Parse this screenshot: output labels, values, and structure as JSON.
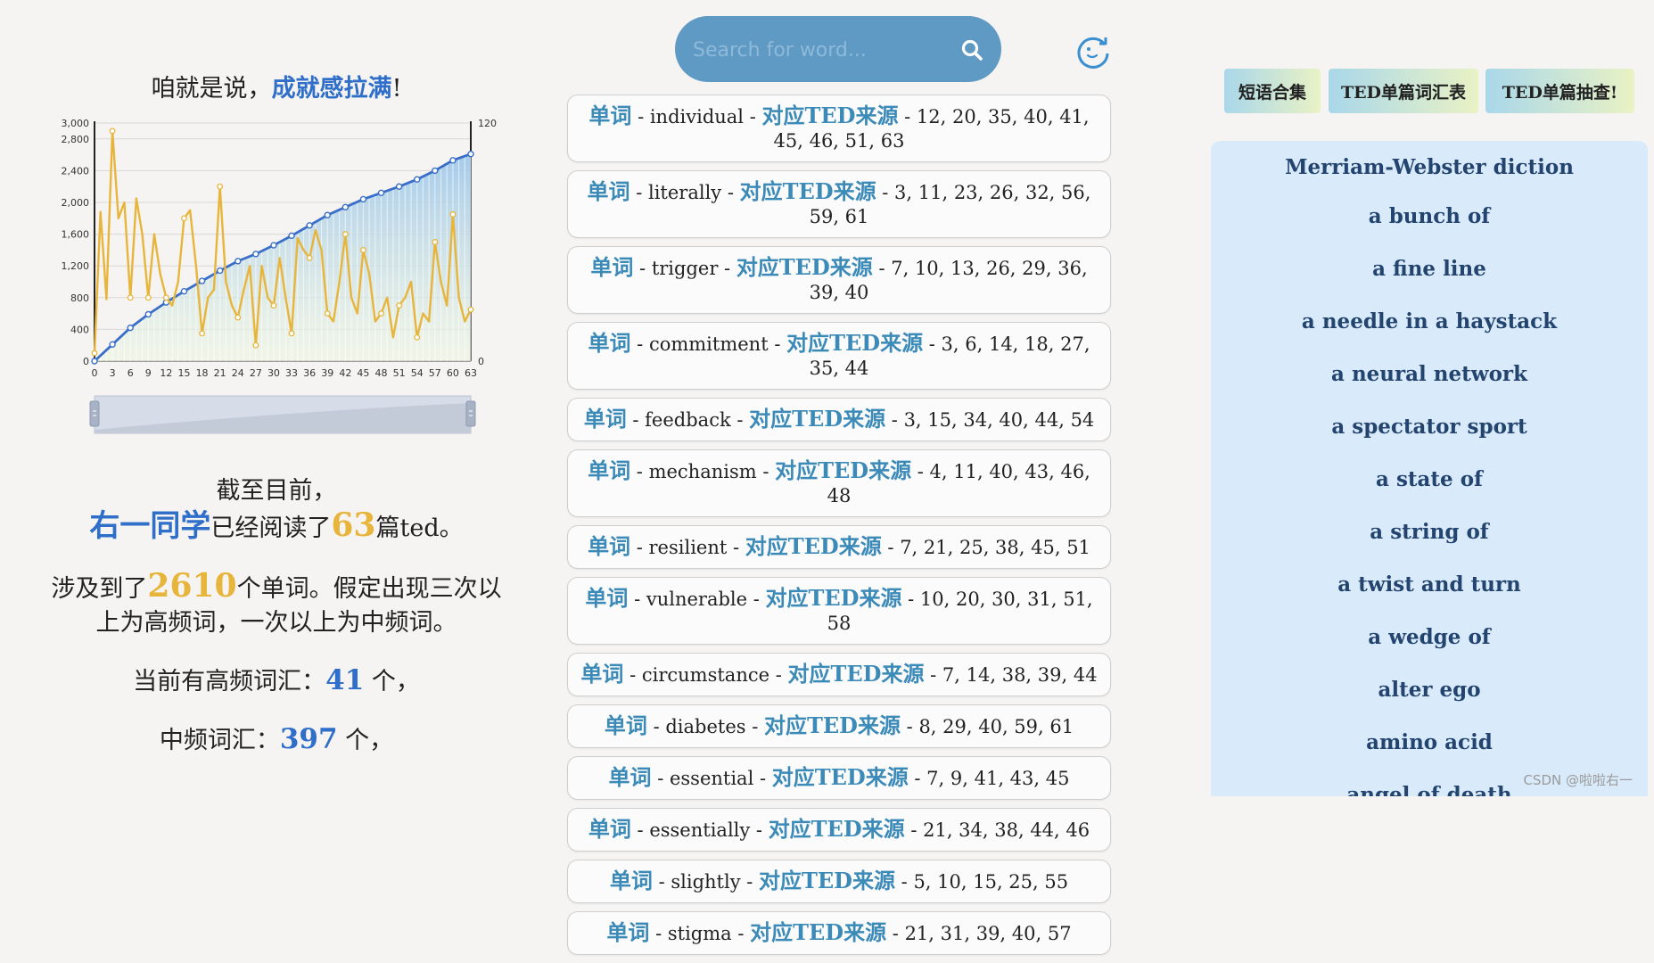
{
  "left": {
    "headline_prefix": "咱就是说，",
    "headline_strong": "成就感拉满",
    "headline_suffix": "!",
    "stats": {
      "line1": "截至目前，",
      "user_name": "右一同学",
      "read_prefix": "已经阅读了",
      "read_count": "63",
      "read_suffix": "篇ted。",
      "words_prefix": "涉及到了",
      "words_count": "2610",
      "words_suffix": "个单词。假定出现三次以",
      "words_line2": "上为高频词，一次以上为中频词。",
      "high_prefix": "当前有高频词汇：",
      "high_count": "41",
      "high_suffix": " 个，",
      "mid_prefix": "中频词汇：",
      "mid_count": "397",
      "mid_suffix": " 个，"
    }
  },
  "chart_data": {
    "type": "line",
    "title": "",
    "x_ticks": [
      "0",
      "3",
      "6",
      "9",
      "12",
      "15",
      "18",
      "21",
      "24",
      "27",
      "30",
      "33",
      "36",
      "39",
      "42",
      "45",
      "48",
      "51",
      "54",
      "57",
      "60",
      "63"
    ],
    "y_left_ticks": [
      "0",
      "400",
      "800",
      "1,200",
      "1,600",
      "2,000",
      "2,400",
      "2,800",
      "3,000"
    ],
    "y_right_ticks": [
      "0",
      "120"
    ],
    "ylim_left": [
      0,
      3000
    ],
    "ylim_right": [
      0,
      120
    ],
    "series": [
      {
        "axis": "left",
        "color": "#3a6fc9",
        "x": [
          0,
          3,
          6,
          9,
          12,
          15,
          18,
          21,
          24,
          27,
          30,
          33,
          36,
          39,
          42,
          45,
          48,
          51,
          54,
          57,
          60,
          63
        ],
        "values": [
          0,
          210,
          420,
          590,
          740,
          880,
          1010,
          1140,
          1260,
          1350,
          1460,
          1580,
          1710,
          1840,
          1940,
          2040,
          2120,
          2200,
          2290,
          2400,
          2530,
          2610
        ]
      },
      {
        "axis": "left",
        "color": "#e8b53c",
        "x": [
          0,
          1,
          2,
          3,
          4,
          5,
          6,
          7,
          8,
          9,
          10,
          11,
          12,
          13,
          14,
          15,
          16,
          17,
          18,
          19,
          20,
          21,
          22,
          23,
          24,
          25,
          26,
          27,
          28,
          29,
          30,
          31,
          32,
          33,
          34,
          35,
          36,
          37,
          38,
          39,
          40,
          41,
          42,
          43,
          44,
          45,
          46,
          47,
          48,
          49,
          50,
          51,
          52,
          53,
          54,
          55,
          56,
          57,
          58,
          59,
          60,
          61,
          62,
          63
        ],
        "values": [
          100,
          1880,
          780,
          2900,
          1800,
          2000,
          800,
          2050,
          1600,
          800,
          1600,
          1100,
          800,
          700,
          1000,
          1800,
          1900,
          1200,
          350,
          800,
          900,
          2200,
          1000,
          700,
          550,
          900,
          1200,
          200,
          1200,
          800,
          700,
          1300,
          800,
          350,
          1550,
          1400,
          1300,
          1650,
          1400,
          600,
          500,
          1000,
          1600,
          800,
          600,
          1400,
          1100,
          500,
          600,
          800,
          300,
          700,
          800,
          1000,
          300,
          600,
          500,
          1500,
          1000,
          700,
          1850,
          800,
          500,
          650
        ]
      }
    ],
    "zoom_slider": {
      "start": 0,
      "end": 100
    }
  },
  "search": {
    "placeholder": "Search for word..."
  },
  "words": [
    {
      "tag": "单词",
      "word": "individual",
      "src_label": "对应TED来源",
      "sources": "12, 20, 35, 40, 41, 45, 46, 51, 63"
    },
    {
      "tag": "单词",
      "word": "literally",
      "src_label": "对应TED来源",
      "sources": "3, 11, 23, 26, 32, 56, 59, 61"
    },
    {
      "tag": "单词",
      "word": "trigger",
      "src_label": "对应TED来源",
      "sources": "7, 10, 13, 26, 29, 36, 39, 40"
    },
    {
      "tag": "单词",
      "word": "commitment",
      "src_label": "对应TED来源",
      "sources": "3, 6, 14, 18, 27, 35, 44"
    },
    {
      "tag": "单词",
      "word": "feedback",
      "src_label": "对应TED来源",
      "sources": "3, 15, 34, 40, 44, 54"
    },
    {
      "tag": "单词",
      "word": "mechanism",
      "src_label": "对应TED来源",
      "sources": "4, 11, 40, 43, 46, 48"
    },
    {
      "tag": "单词",
      "word": "resilient",
      "src_label": "对应TED来源",
      "sources": "7, 21, 25, 38, 45, 51"
    },
    {
      "tag": "单词",
      "word": "vulnerable",
      "src_label": "对应TED来源",
      "sources": "10, 20, 30, 31, 51, 58"
    },
    {
      "tag": "单词",
      "word": "circumstance",
      "src_label": "对应TED来源",
      "sources": "7, 14, 38, 39, 44"
    },
    {
      "tag": "单词",
      "word": "diabetes",
      "src_label": "对应TED来源",
      "sources": "8, 29, 40, 59, 61"
    },
    {
      "tag": "单词",
      "word": "essential",
      "src_label": "对应TED来源",
      "sources": "7, 9, 41, 43, 45"
    },
    {
      "tag": "单词",
      "word": "essentially",
      "src_label": "对应TED来源",
      "sources": "21, 34, 38, 44, 46"
    },
    {
      "tag": "单词",
      "word": "slightly",
      "src_label": "对应TED来源",
      "sources": "5, 10, 15, 25, 55"
    },
    {
      "tag": "单词",
      "word": "stigma",
      "src_label": "对应TED来源",
      "sources": "21, 31, 39, 40, 57"
    }
  ],
  "tabs": [
    "短语合集",
    "TED单篇词汇表",
    "TED单篇抽查!"
  ],
  "phrases": {
    "title": "Merriam-Webster diction",
    "items": [
      "a bunch of",
      "a fine line",
      "a needle in a haystack",
      "a neural network",
      "a spectator sport",
      "a state of",
      "a string of",
      "a twist and turn",
      "a wedge of",
      "alter ego",
      "amino acid",
      "angel of death"
    ]
  },
  "watermark": "CSDN @啦啦右一",
  "colors": {
    "accent_blue": "#2f6fc9",
    "gold": "#e8b53c",
    "tag_blue": "#3b8ab8",
    "search_bg": "#5f9ac4",
    "panel_bg": "#d9ebfb"
  }
}
